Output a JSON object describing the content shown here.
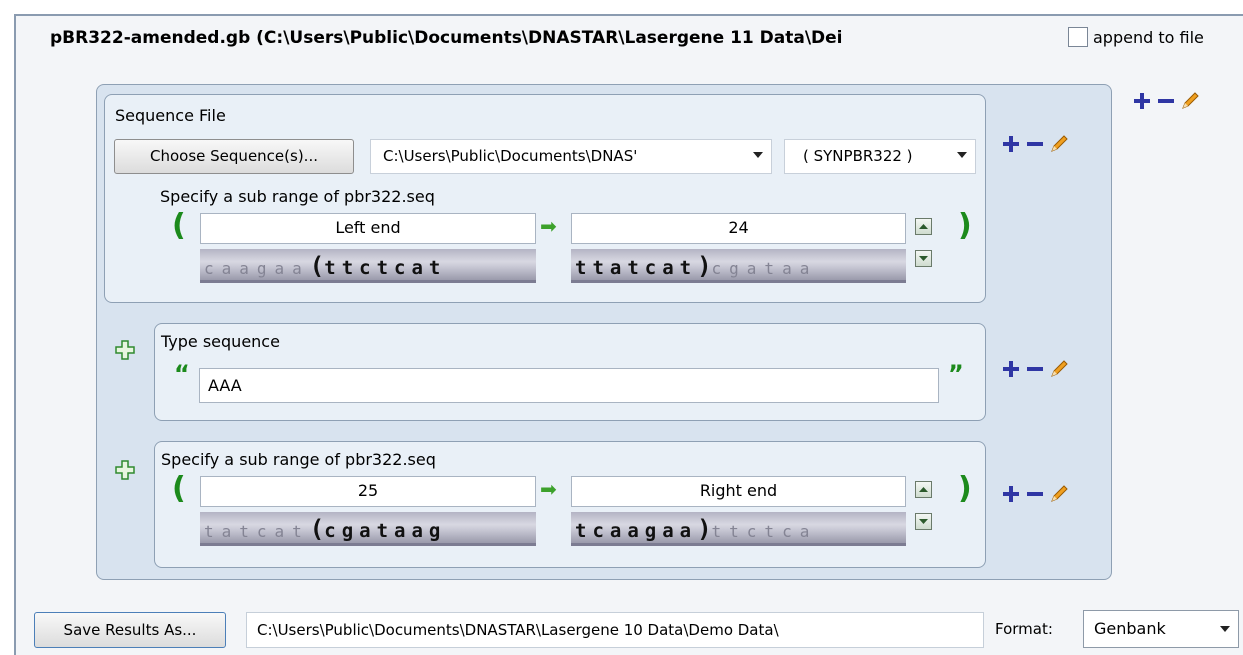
{
  "header": {
    "title": "pBR322-amended.gb  (C:\\Users\\Public\\Documents\\DNASTAR\\Lasergene 11 Data\\Dei",
    "append_label": "append to file"
  },
  "sequence_file": {
    "group_label": "Sequence File",
    "choose_button": "Choose Sequence(s)...",
    "path_value": "C:\\Users\\Public\\Documents\\DNAS'",
    "name_value": "( SYNPBR322 )",
    "subrange_label": "Specify a sub range of pbr322.seq",
    "left_value": "Left end",
    "right_value": "24",
    "left_seq_light": "caagaa",
    "left_seq_bold": "ttctcat",
    "right_seq_bold": "ttatcat",
    "right_seq_light": "cgataa",
    "open_paren": "(",
    "close_paren": ")"
  },
  "type_sequence": {
    "label": "Type sequence",
    "value": "AAA",
    "open_quote": "“",
    "close_quote": "”"
  },
  "subrange2": {
    "label": "Specify a sub range of pbr322.seq",
    "left_value": "25",
    "right_value": "Right end",
    "left_seq_light": "tatcat",
    "left_seq_bold": "cgataag",
    "right_seq_bold": "tcaagaa",
    "right_seq_light": "ttctca",
    "open_paren": "(",
    "close_paren": ")"
  },
  "footer": {
    "save_button": "Save Results As...",
    "save_path": "C:\\Users\\Public\\Documents\\DNASTAR\\Lasergene 10 Data\\Demo Data\\",
    "format_label": "Format:",
    "format_value": "Genbank"
  },
  "icons": {
    "add": "plus-icon",
    "remove": "minus-icon",
    "edit": "pencil-icon",
    "insert": "green-plus-icon",
    "spin_up": "chevron-up-icon",
    "spin_down": "chevron-down-icon",
    "range_arrow": "right-arrow-icon"
  },
  "colors": {
    "accent_blue": "#2f36a4",
    "accent_green": "#1c8a1c",
    "pencil_orange": "#f0a020"
  }
}
